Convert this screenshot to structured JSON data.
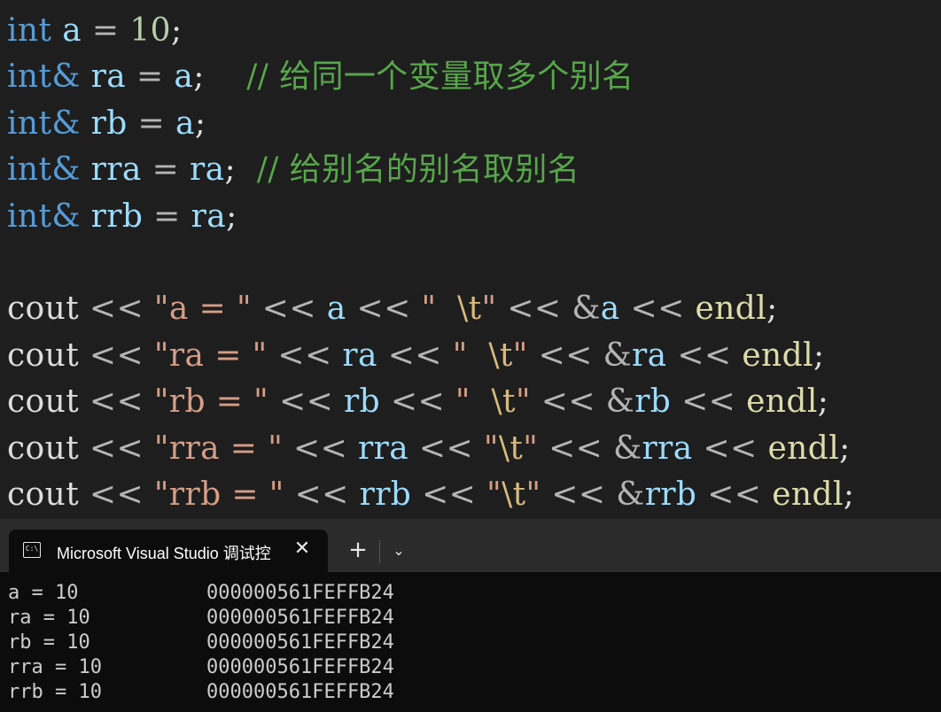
{
  "editor": {
    "lines": [
      {
        "t1": "int",
        "t2": " ",
        "t3": "a",
        "t4": " = ",
        "t5": "10",
        "t6": ";"
      },
      {
        "t1": "int&",
        "t2": " ",
        "t3": "ra",
        "t4": " = ",
        "t5": "a",
        "t6": ";",
        "t7": "    ",
        "t8": "// 给同一个变量取多个别名"
      },
      {
        "t1": "int&",
        "t2": " ",
        "t3": "rb",
        "t4": " = ",
        "t5": "a",
        "t6": ";"
      },
      {
        "t1": "int&",
        "t2": " ",
        "t3": "rra",
        "t4": " = ",
        "t5": "ra",
        "t6": ";",
        "t7": "  ",
        "t8": "// 给别名的别名取别名"
      },
      {
        "t1": "int&",
        "t2": " ",
        "t3": "rrb",
        "t4": " = ",
        "t5": "ra",
        "t6": ";"
      }
    ],
    "cout_lines": [
      {
        "c": "cout",
        " o1": " << ",
        "s1": "\"a = \"",
        "o2": " << ",
        "v": "a",
        "o3": " << ",
        "s2": "\"  ",
        "e": "\\t",
        "s3": "\"",
        "o4": " << ",
        "amp": "&",
        "av": "a",
        "o5": " << ",
        "endl": "endl",
        "semi": ";"
      },
      {
        "c": "cout",
        "o1": " << ",
        "s1": "\"ra = \"",
        "o2": " << ",
        "v": "ra",
        "o3": " << ",
        "s2": "\"  ",
        "e": "\\t",
        "s3": "\"",
        "o4": " << ",
        "amp": "&",
        "av": "ra",
        "o5": " << ",
        "endl": "endl",
        "semi": ";"
      },
      {
        "c": "cout",
        "o1": " << ",
        "s1": "\"rb = \"",
        "o2": " << ",
        "v": "rb",
        "o3": " << ",
        "s2": "\"  ",
        "e": "\\t",
        "s3": "\"",
        "o4": " << ",
        "amp": "&",
        "av": "rb",
        "o5": " << ",
        "endl": "endl",
        "semi": ";"
      },
      {
        "c": "cout",
        "o1": " << ",
        "s1": "\"rra = \"",
        "o2": " << ",
        "v": "rra",
        "o3": " << ",
        "s2": "\"",
        "e": "\\t",
        "s3": "\"",
        "o4": " << ",
        "amp": "&",
        "av": "rra",
        "o5": " << ",
        "endl": "endl",
        "semi": ";"
      },
      {
        "c": "cout",
        "o1": " << ",
        "s1": "\"rrb = \"",
        "o2": " << ",
        "v": "rrb",
        "o3": " << ",
        "s2": "\"",
        "e": "\\t",
        "s3": "\"",
        "o4": " << ",
        "amp": "&",
        "av": "rrb",
        "o5": " << ",
        "endl": "endl",
        "semi": ";"
      }
    ]
  },
  "terminal": {
    "tab_icon_text": "C:\\",
    "tab_title": "Microsoft Visual Studio 调试控",
    "close_glyph": "✕",
    "new_tab_glyph": "+",
    "dropdown_glyph": "⌄",
    "output": [
      {
        "val": "a = 10",
        "addr": "000000561FEFFB24"
      },
      {
        "val": "ra = 10",
        "addr": "000000561FEFFB24"
      },
      {
        "val": "rb = 10",
        "addr": "000000561FEFFB24"
      },
      {
        "val": "rra = 10",
        "addr": "000000561FEFFB24"
      },
      {
        "val": "rrb = 10",
        "addr": "000000561FEFFB24"
      }
    ]
  },
  "colors": {
    "keyword": "#569cd6",
    "variable": "#9cdcfe",
    "number": "#b5cea8",
    "string": "#d69d85",
    "escape": "#d7ba7d",
    "function": "#dcdcaa",
    "comment": "#57a64a"
  }
}
